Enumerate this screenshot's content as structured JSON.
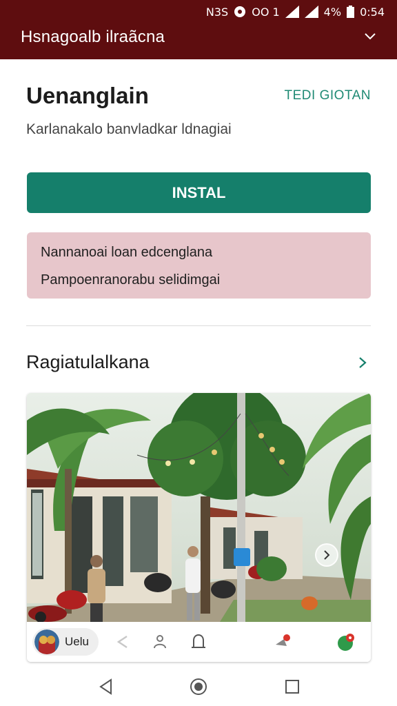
{
  "status_bar": {
    "left_text": "N3S",
    "mid_text": "OO 1",
    "battery": "4%",
    "time": "0:54"
  },
  "header": {
    "title": "Hsnagoalb ilraãcna"
  },
  "app": {
    "name": "Uenanglain",
    "tag": "TEDI GIOTAN",
    "subtitle": "Karlanakalo banvladkar ldnagiai"
  },
  "install": {
    "label": "INSTAL"
  },
  "notice": {
    "line1": "Nannanoai loan edcenglana",
    "line2": "Pampoenranorabu selidimgai"
  },
  "section": {
    "title": "Ragiatulalkana"
  },
  "card": {
    "chip_label": "Uelu"
  },
  "colors": {
    "header_bg": "#5e0d0f",
    "accent": "#157f6b",
    "notice_bg": "#e7c6cb"
  }
}
